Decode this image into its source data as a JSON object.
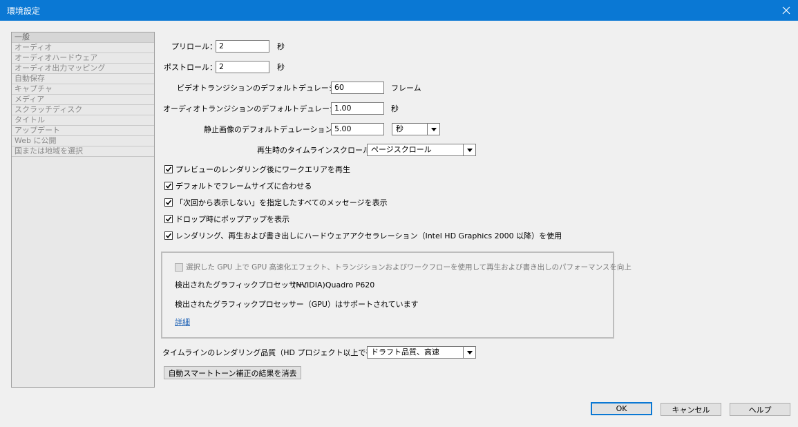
{
  "window": {
    "title": "環境設定"
  },
  "sidebar": {
    "items": [
      "一般",
      "オーディオ",
      "オーディオハードウェア",
      "オーディオ出力マッピング",
      "自動保存",
      "キャプチャ",
      "メディア",
      "スクラッチディスク",
      "タイトル",
      "アップデート",
      "Web に公開",
      "国または地域を選択"
    ]
  },
  "general": {
    "preroll_label": "プリロール：",
    "preroll_value": "2",
    "preroll_unit": "秒",
    "postroll_label": "ポストロール：",
    "postroll_value": "2",
    "postroll_unit": "秒",
    "video_transition_label": "ビデオトランジションのデフォルトデュレーション：",
    "video_transition_value": "60",
    "video_transition_unit": "フレーム",
    "audio_transition_label": "オーディオトランジションのデフォルトデュレーション：",
    "audio_transition_value": "1.00",
    "audio_transition_unit": "秒",
    "still_image_label": "静止画像のデフォルトデュレーション：",
    "still_image_value": "5.00",
    "still_image_unit_selected": "秒",
    "timeline_scroll_label": "再生時のタイムラインスクロール：",
    "timeline_scroll_selected": "ページスクロール"
  },
  "checkboxes": [
    {
      "label": "プレビューのレンダリング後にワークエリアを再生",
      "checked": true
    },
    {
      "label": "デフォルトでフレームサイズに合わせる",
      "checked": true
    },
    {
      "label": "「次回から表示しない」を指定したすべてのメッセージを表示",
      "checked": true
    },
    {
      "label": "ドロップ時にポップアップを表示",
      "checked": true
    },
    {
      "label": "レンダリング、再生および書き出しにハードウェアアクセラレーション（Intel HD Graphics 2000 以降）を使用",
      "checked": true
    }
  ],
  "gpu": {
    "checkbox_label": "選択した GPU 上で GPU 高速化エフェクト、トランジションおよびワークフローを使用して再生および書き出しのパフォーマンスを向上",
    "checkbox_checked": false,
    "detected_label": "検出されたグラフィックプロセッサー：",
    "detected_value": "(NVIDIA)Quadro P620",
    "supported_text": "検出されたグラフィックプロセッサー（GPU）はサポートされています",
    "details_link": "詳細"
  },
  "render_quality": {
    "label": "タイムラインのレンダリング品質（HD プロジェクト以上で有効）：",
    "selected": "ドラフト品質、高速"
  },
  "clear_button": "自動スマートトーン補正の結果を消去",
  "footer": {
    "ok": "OK",
    "cancel": "キャンセル",
    "help": "ヘルプ"
  },
  "colors": {
    "titlebar": "#0a78d4",
    "background": "#f0f0f0"
  }
}
